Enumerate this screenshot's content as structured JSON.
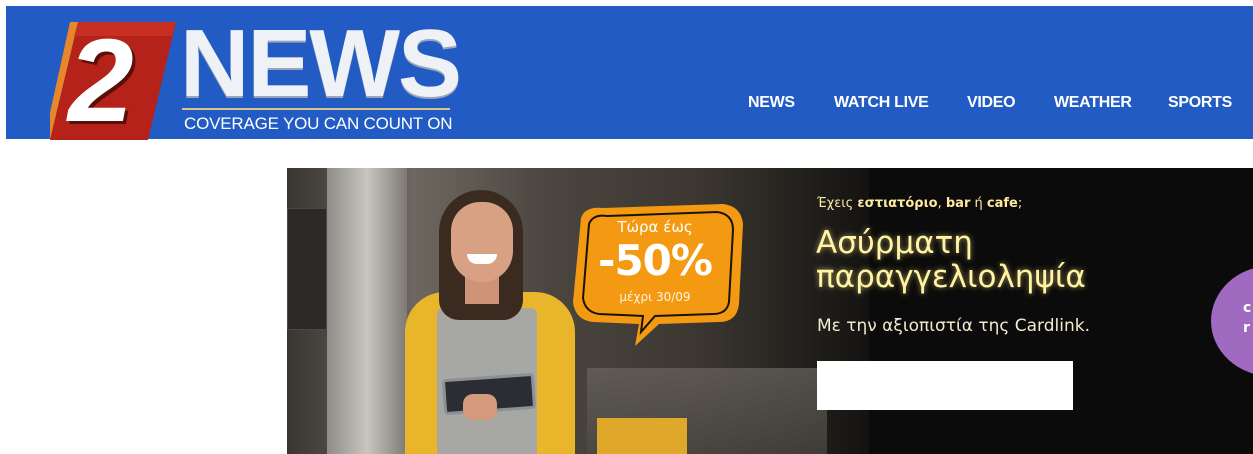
{
  "header": {
    "logo": {
      "number": "2",
      "word": "NEWS",
      "tagline": "COVERAGE YOU CAN COUNT ON"
    },
    "nav": [
      {
        "label": "NEWS"
      },
      {
        "label": "WATCH LIVE"
      },
      {
        "label": "VIDEO"
      },
      {
        "label": "WEATHER"
      },
      {
        "label": "SPORTS"
      }
    ],
    "colors": {
      "bar": "#225bc4",
      "logo_red": "#b5221a",
      "logo_orange": "#e8862a"
    }
  },
  "ad": {
    "bubble": {
      "line1": "Τώρα έως",
      "line2": "-50%",
      "line3": "μέχρι 30/09"
    },
    "eyebrow": {
      "pre": "Έχεις ",
      "b1": "εστιατόριο",
      "mid1": ", ",
      "b2": "bar",
      "mid2": " ή ",
      "b3": "cafe",
      "post": ";"
    },
    "title_line1": "Ασύρματη",
    "title_line2": "παραγγελιοληψία",
    "subtitle": "Με την αξιοπιστία της Cardlink.",
    "partial_right": {
      "line1": "c",
      "line2": "r"
    },
    "colors": {
      "bubble": "#f39a12",
      "title": "#fff3a8",
      "purple": "#a06ac0"
    }
  }
}
